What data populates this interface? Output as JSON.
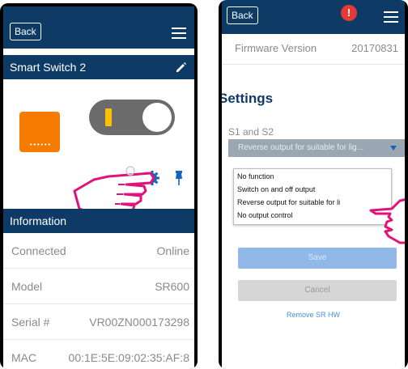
{
  "left_phone": {
    "back_label": "Back",
    "device_name": "Smart Switch 2",
    "info_title": "Information",
    "info_rows": [
      {
        "label": "Connected",
        "value": "Online"
      },
      {
        "label": "Model",
        "value": "SR600"
      },
      {
        "label": "Serial #",
        "value": "VR00ZN000173298"
      },
      {
        "label": "MAC",
        "value": "00:1E:5E:09:02:35:AF:8"
      }
    ],
    "colors": {
      "header": "#0d3b66",
      "device": "#f57c00",
      "toggle_on": "#ffc107",
      "gear": "#1565c0",
      "hand": "#e0137a"
    }
  },
  "right_phone": {
    "back_label": "Back",
    "alert_glyph": "!",
    "firmware_label": "Firmware Version",
    "firmware_value": "20170831",
    "settings_title": "Settings",
    "select_label": "S1 and S2",
    "select_value": "Reverse output for suitable for lig...",
    "options": [
      "No function",
      "Switch on and off output",
      "Reverse output for suitable for li",
      "No output control"
    ],
    "save_label": "Save",
    "cancel_label": "Cancel",
    "remove_label": "Remove SR HW"
  }
}
